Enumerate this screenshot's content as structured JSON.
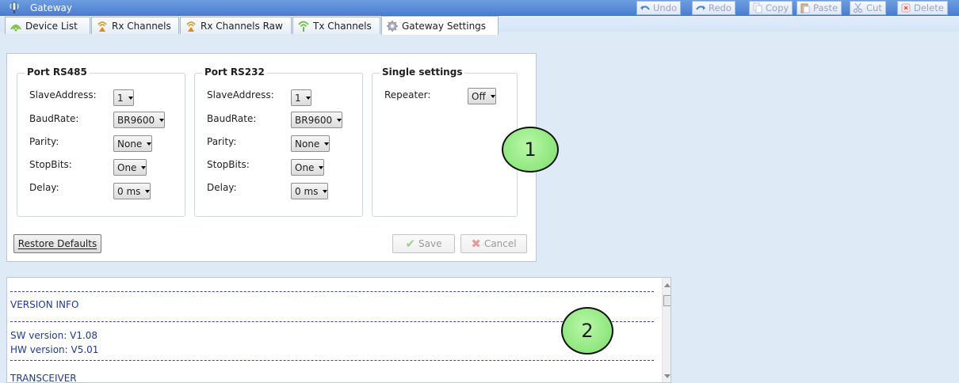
{
  "window": {
    "title": "Gateway"
  },
  "toolbar": {
    "undo": "Undo",
    "redo": "Redo",
    "copy": "Copy",
    "paste": "Paste",
    "cut": "Cut",
    "delete": "Delete"
  },
  "tabs": [
    {
      "label": "Device List"
    },
    {
      "label": "Rx Channels"
    },
    {
      "label": "Rx Channels Raw"
    },
    {
      "label": "Tx Channels"
    },
    {
      "label": "Gateway Settings",
      "active": true
    }
  ],
  "rs485": {
    "title": "Port RS485",
    "slave_label": "SlaveAddress:",
    "slave_value": "1",
    "baud_label": "BaudRate:",
    "baud_value": "BR9600",
    "parity_label": "Parity:",
    "parity_value": "None",
    "stop_label": "StopBits:",
    "stop_value": "One",
    "delay_label": "Delay:",
    "delay_value": "0 ms"
  },
  "rs232": {
    "title": "Port RS232",
    "slave_label": "SlaveAddress:",
    "slave_value": "1",
    "baud_label": "BaudRate:",
    "baud_value": "BR9600",
    "parity_label": "Parity:",
    "parity_value": "None",
    "stop_label": "StopBits:",
    "stop_value": "One",
    "delay_label": "Delay:",
    "delay_value": "0 ms"
  },
  "single": {
    "title": "Single settings",
    "repeater_label": "Repeater:",
    "repeater_value": "Off"
  },
  "buttons": {
    "restore": "Restore Defaults",
    "save": "Save",
    "cancel": "Cancel"
  },
  "callouts": {
    "one": "1",
    "two": "2"
  },
  "log": {
    "version_header": "VERSION INFO",
    "sw": "SW version: V1.08",
    "hw": "HW version: V5.01",
    "transceiver": "TRANSCEIVER"
  }
}
